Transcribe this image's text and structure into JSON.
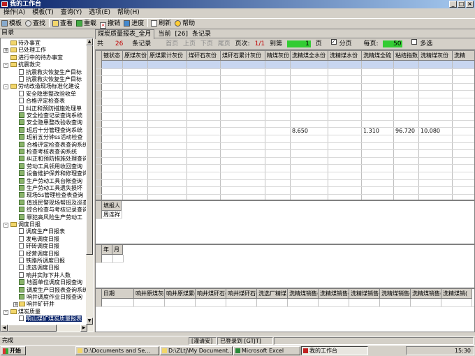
{
  "window": {
    "title": "我的工作台"
  },
  "menu": [
    "操作(A)",
    "模板(T)",
    "查询(Y)",
    "选项(E)",
    "帮助(H)"
  ],
  "toolbar": [
    "模板",
    "查找",
    "查看",
    "重载",
    "撤销",
    "进度",
    "刷新",
    "帮助"
  ],
  "left": {
    "header": "目录",
    "tree": [
      {
        "label": "待办事宜",
        "icon": "folder",
        "level": 0,
        "expander": ""
      },
      {
        "label": "已处理工作",
        "icon": "folder",
        "level": 0,
        "expander": "+"
      },
      {
        "label": "进行中的待办事宜",
        "icon": "folder",
        "level": 0,
        "expander": ""
      },
      {
        "label": "抗震救灾",
        "icon": "folder",
        "level": 0,
        "expander": "-"
      },
      {
        "label": "抗震救灾恢复生产目标",
        "icon": "doc",
        "level": 1,
        "expander": ""
      },
      {
        "label": "抗震救灾恢复生产目标",
        "icon": "doc",
        "level": 1,
        "expander": ""
      },
      {
        "label": "劳动改造现场标准化建设",
        "icon": "folder",
        "level": 0,
        "expander": "-"
      },
      {
        "label": "安全隐患整改验收单",
        "icon": "doc",
        "level": 1,
        "expander": ""
      },
      {
        "label": "合格评定检查表",
        "icon": "doc",
        "level": 1,
        "expander": ""
      },
      {
        "label": "纠正和预防措施处理单",
        "icon": "doc",
        "level": 1,
        "expander": ""
      },
      {
        "label": "安全检查记录查询系统",
        "icon": "docg",
        "level": 1,
        "expander": ""
      },
      {
        "label": "安全隐患整改验收查询",
        "icon": "docg",
        "level": 1,
        "expander": ""
      },
      {
        "label": "班后十分管理查询系统",
        "icon": "docg",
        "level": 1,
        "expander": ""
      },
      {
        "label": "班前五分钟ss活动检查",
        "icon": "docg",
        "level": 1,
        "expander": ""
      },
      {
        "label": "合格评定检查表查询系统",
        "icon": "docg",
        "level": 1,
        "expander": ""
      },
      {
        "label": "检查考核表查询系统",
        "icon": "docg",
        "level": 1,
        "expander": ""
      },
      {
        "label": "纠正和预防措施处理查询",
        "icon": "docg",
        "level": 1,
        "expander": ""
      },
      {
        "label": "劳动工具领用收回查询",
        "icon": "docg",
        "level": 1,
        "expander": ""
      },
      {
        "label": "设备维护保养和修理查询",
        "icon": "docg",
        "level": 1,
        "expander": ""
      },
      {
        "label": "生产劳动工具台帐查询",
        "icon": "docg",
        "level": 1,
        "expander": ""
      },
      {
        "label": "生产劳动工具遗失损坏",
        "icon": "docg",
        "level": 1,
        "expander": ""
      },
      {
        "label": "现场5s管理检查表查询",
        "icon": "docg",
        "level": 1,
        "expander": ""
      },
      {
        "label": "值班民警现场帮班及巡查",
        "icon": "docg",
        "level": 1,
        "expander": ""
      },
      {
        "label": "综合检查与考核记录查询",
        "icon": "docg",
        "level": 1,
        "expander": ""
      },
      {
        "label": "罪犯高风险生产劳动工",
        "icon": "docg",
        "level": 1,
        "expander": ""
      },
      {
        "label": "调度日报",
        "icon": "folder",
        "level": 0,
        "expander": "-"
      },
      {
        "label": "调度生产日报表",
        "icon": "doc",
        "level": 1,
        "expander": ""
      },
      {
        "label": "发电调度日报",
        "icon": "doc",
        "level": 1,
        "expander": ""
      },
      {
        "label": "矸砖调度日报",
        "icon": "doc",
        "level": 1,
        "expander": ""
      },
      {
        "label": "经营调度日报",
        "icon": "doc",
        "level": 1,
        "expander": ""
      },
      {
        "label": "铁路所调度日报",
        "icon": "doc",
        "level": 1,
        "expander": ""
      },
      {
        "label": "洗选调度日报",
        "icon": "doc",
        "level": 1,
        "expander": ""
      },
      {
        "label": "响井实际下井人数",
        "icon": "doc",
        "level": 1,
        "expander": ""
      },
      {
        "label": "地面单位调度日报查询",
        "icon": "docg",
        "level": 1,
        "expander": ""
      },
      {
        "label": "调度生产日报表查询系统",
        "icon": "docg",
        "level": 1,
        "expander": ""
      },
      {
        "label": "响井调度作业日报查询",
        "icon": "docg",
        "level": 1,
        "expander": ""
      },
      {
        "label": "响井矿矸井",
        "icon": "folder",
        "level": 1,
        "expander": "+"
      },
      {
        "label": "煤炭质量",
        "icon": "folder",
        "level": 0,
        "expander": "-"
      },
      {
        "label": "响山煤矿煤炭质量报表",
        "icon": "doc",
        "level": 1,
        "expander": "",
        "selected": true
      }
    ]
  },
  "report": {
    "tab": "煤炭质量报表_全月",
    "current_label": "当前",
    "current_value": "[26]",
    "records_label": "条记录"
  },
  "pager": {
    "total_label": "共",
    "total": "26",
    "records_label": "条记录",
    "first": "首页",
    "prev": "上页",
    "next": "下页",
    "last": "尾页",
    "page_label": "页次:",
    "page": "1/1",
    "goto_label": "到第",
    "goto_value": "1",
    "page_unit": "页",
    "paging_label": "分页",
    "per_page_label": "每页:",
    "per_page": "50",
    "multi_label": "多选"
  },
  "grid1": {
    "columns": [
      "镀状态",
      "原煤灰份",
      "原煤累计灰份",
      "煤矸石灰份",
      "煤矸石累计灰份",
      "精煤灰份",
      "洗精煤全水份",
      "洗精煤水份",
      "洗精煤全硫",
      "粘结指数",
      "洗精煤灰份",
      "洗精"
    ],
    "value_row": [
      "",
      "",
      "",
      "",
      "",
      "",
      "8.650",
      "",
      "1.310",
      "96.720",
      "10.080",
      ""
    ]
  },
  "grid2": {
    "columns": [
      "填报人"
    ],
    "value": "周连祥"
  },
  "grid3": {
    "columns": [
      "年",
      "月"
    ]
  },
  "grid4": {
    "columns": [
      "日期",
      "响井原煤灰(",
      "响井原煤累(",
      "响井煤矸石(",
      "响井煤矸石(",
      "洗选厂精煤",
      "洗精煤销售(",
      "洗精煤销售(",
      "洗精煤销售(",
      "洗精煤销售(",
      "洗精煤销售(",
      "洗精煤销("
    ]
  },
  "status": {
    "left": "完成",
    "p2": "[灌请安]",
    "p3": "已登录到 [GTJT]"
  },
  "taskbar": {
    "start": "开始",
    "tasks": [
      "D:\\Documents and Se...",
      "D:\\ZLtj\\My Document...",
      "Microsoft Excel",
      "我的工作台"
    ],
    "clock": "15:30"
  }
}
